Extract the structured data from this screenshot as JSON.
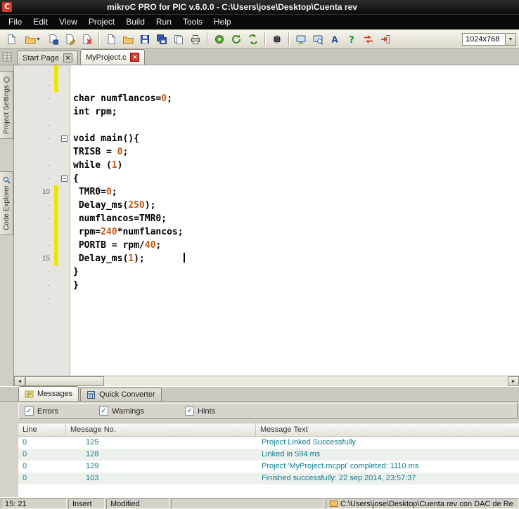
{
  "colors": {
    "accent_red": "#d23b29",
    "modified_bar": "#f0e400",
    "number_token": "#c65911",
    "message_text": "#0d7b8e"
  },
  "window": {
    "logo_letter": "C",
    "title": "mikroC PRO for PIC v.6.0.0 - C:\\Users\\jose\\Desktop\\Cuenta rev"
  },
  "menu": {
    "items": [
      "File",
      "Edit",
      "View",
      "Project",
      "Build",
      "Run",
      "Tools",
      "Help"
    ]
  },
  "toolbar": {
    "resolution": "1024x768",
    "groups": [
      {
        "buttons": [
          {
            "name": "new-project-button",
            "icon": "new-page"
          },
          {
            "name": "open-project-button",
            "icon": "folder-open",
            "dropdown": true
          },
          {
            "name": "save-project-button",
            "icon": "page-save"
          },
          {
            "name": "edit-project-button",
            "icon": "page-edit"
          },
          {
            "name": "close-project-button",
            "icon": "page-delete"
          }
        ]
      },
      {
        "buttons": [
          {
            "name": "new-file-button",
            "icon": "new-page"
          },
          {
            "name": "open-file-button",
            "icon": "folder-open"
          },
          {
            "name": "save-file-button",
            "icon": "floppy"
          },
          {
            "name": "save-all-button",
            "icon": "floppy-multi"
          },
          {
            "name": "copy-button",
            "icon": "copy"
          },
          {
            "name": "print-button",
            "icon": "printer"
          }
        ]
      },
      {
        "buttons": [
          {
            "name": "compile-button",
            "icon": "gear-green"
          },
          {
            "name": "rebuild-all-button",
            "icon": "gear-refresh"
          },
          {
            "name": "build-all-button",
            "icon": "gear-all"
          }
        ]
      },
      {
        "buttons": [
          {
            "name": "program-button",
            "icon": "chip-program"
          }
        ]
      },
      {
        "buttons": [
          {
            "name": "debugger-button",
            "icon": "monitor"
          },
          {
            "name": "watch-window-button",
            "icon": "monitor-watch"
          },
          {
            "name": "editor-font-button",
            "icon": "letter-a"
          },
          {
            "name": "help-button",
            "icon": "question"
          },
          {
            "name": "swap-view-button",
            "icon": "swap-red"
          },
          {
            "name": "export-button",
            "icon": "export-red"
          }
        ]
      }
    ]
  },
  "tabs": [
    {
      "label": "Start Page"
    },
    {
      "label": "MyProject.c"
    }
  ],
  "dock": {
    "tabs": [
      {
        "label": "Project Settings"
      },
      {
        "label": "Code Explorer"
      }
    ]
  },
  "editor": {
    "lines": [
      {
        "g": "·",
        "mod": true,
        "tokens": []
      },
      {
        "g": "·",
        "mod": true,
        "tokens": []
      },
      {
        "g": "·",
        "tokens": [
          [
            "k",
            "char"
          ],
          [
            "p",
            " numflancos="
          ],
          [
            "n",
            "0"
          ],
          [
            "p",
            ";"
          ]
        ]
      },
      {
        "g": "·",
        "tokens": [
          [
            "k",
            "int"
          ],
          [
            "p",
            " rpm;"
          ]
        ]
      },
      {
        "g": "·",
        "tokens": []
      },
      {
        "g": "·",
        "fold": true,
        "tokens": [
          [
            "k",
            "void"
          ],
          [
            "p",
            " main(){"
          ]
        ]
      },
      {
        "g": "·",
        "tokens": [
          [
            "p",
            "TRISB = "
          ],
          [
            "n",
            "0"
          ],
          [
            "p",
            ";"
          ]
        ]
      },
      {
        "g": "·",
        "tokens": [
          [
            "k",
            "while"
          ],
          [
            "p",
            " ("
          ],
          [
            "n",
            "1"
          ],
          [
            "p",
            ")"
          ]
        ]
      },
      {
        "g": "·",
        "fold": true,
        "tokens": [
          [
            "p",
            "{"
          ]
        ]
      },
      {
        "g": "10",
        "mod": true,
        "tokens": [
          [
            "p",
            " TMR0="
          ],
          [
            "n",
            "0"
          ],
          [
            "p",
            ";"
          ]
        ]
      },
      {
        "g": "·",
        "mod": true,
        "tokens": [
          [
            "p",
            " Delay_ms("
          ],
          [
            "n",
            "250"
          ],
          [
            "p",
            ");"
          ]
        ]
      },
      {
        "g": "·",
        "mod": true,
        "tokens": [
          [
            "p",
            " numflancos=TMR0;"
          ]
        ]
      },
      {
        "g": "·",
        "mod": true,
        "tokens": [
          [
            "p",
            " rpm="
          ],
          [
            "n",
            "240"
          ],
          [
            "p",
            "*numflancos;"
          ]
        ]
      },
      {
        "g": "·",
        "mod": true,
        "tokens": [
          [
            "p",
            " PORTB = rpm/"
          ],
          [
            "n",
            "40"
          ],
          [
            "p",
            ";"
          ]
        ]
      },
      {
        "g": "15",
        "mod": true,
        "caret_after": 20,
        "tokens": [
          [
            "p",
            " Delay_ms("
          ],
          [
            "n",
            "1"
          ],
          [
            "p",
            ");"
          ]
        ]
      },
      {
        "g": "·",
        "tokens": [
          [
            "p",
            "}"
          ]
        ]
      },
      {
        "g": "·",
        "tokens": [
          [
            "p",
            "}"
          ]
        ]
      },
      {
        "g": "·",
        "tokens": []
      }
    ]
  },
  "messages": {
    "tabs": [
      "Messages",
      "Quick Converter"
    ],
    "filters": [
      {
        "label": "Errors",
        "checked": true
      },
      {
        "label": "Warnings",
        "checked": true
      },
      {
        "label": "Hints",
        "checked": true
      }
    ],
    "table": {
      "headers": [
        "Line",
        "Message No.",
        "Message Text"
      ],
      "rows": [
        [
          "0",
          "125",
          "Project Linked Successfully"
        ],
        [
          "0",
          "128",
          "Linked in 594 ms"
        ],
        [
          "0",
          "129",
          "Project 'MyProject.mcppi' completed: 1110 ms"
        ],
        [
          "0",
          "103",
          "Finished successfully: 22 sep 2014, 23:57:37"
        ]
      ]
    }
  },
  "status": {
    "position": "15: 21",
    "mode": "Insert",
    "state": "Modified",
    "path": "C:\\Users\\jose\\Desktop\\Cuenta rev con DAC de Re"
  }
}
